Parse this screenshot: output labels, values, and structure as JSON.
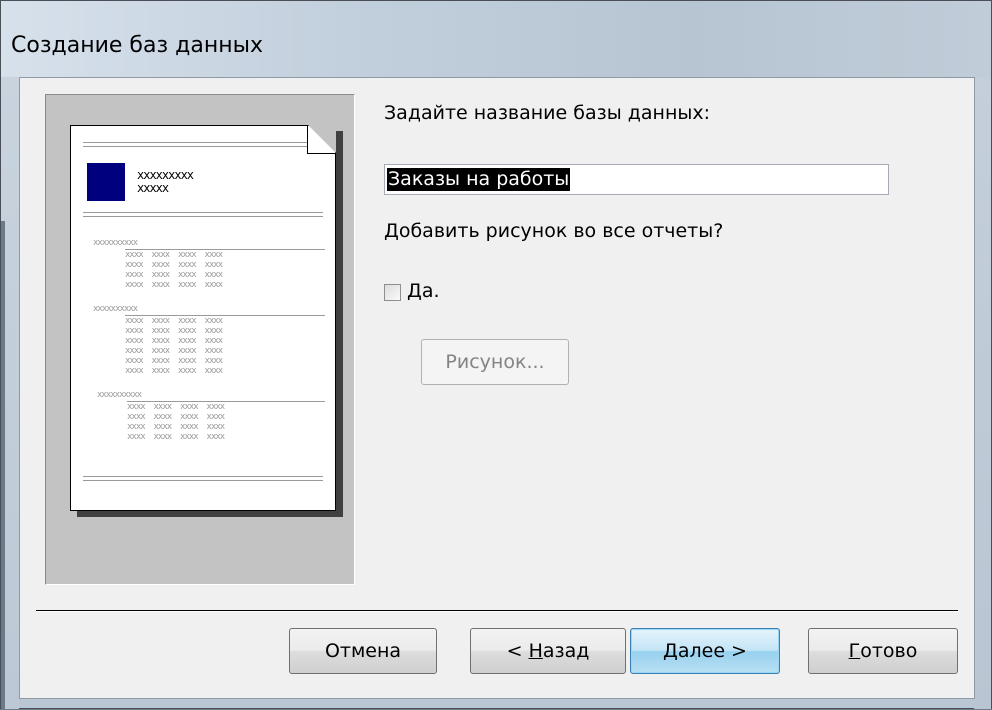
{
  "window": {
    "title": "Создание баз данных"
  },
  "preview": {
    "doc_header_line1": "xxxxxxxxx",
    "doc_header_line2": "xxxxx",
    "group_label": "xxxxxxxxxx",
    "row_text": "xxxx  xxxx  xxxx  xxxx",
    "logo_color": "#00007f"
  },
  "form": {
    "name_label": "Задайте название базы данных:",
    "name_value": "Заказы на работы",
    "picture_question": "Добавить рисунок во все отчеты?",
    "checkbox_label": "Да.",
    "checkbox_checked": false,
    "picture_button": "Рисунок..."
  },
  "buttons": {
    "cancel": "Отмена",
    "back_prefix": "< ",
    "back_u": "Н",
    "back_rest": "азад",
    "next_u": "Д",
    "next_rest": "алее >",
    "finish_u": "Г",
    "finish_rest": "отово"
  }
}
